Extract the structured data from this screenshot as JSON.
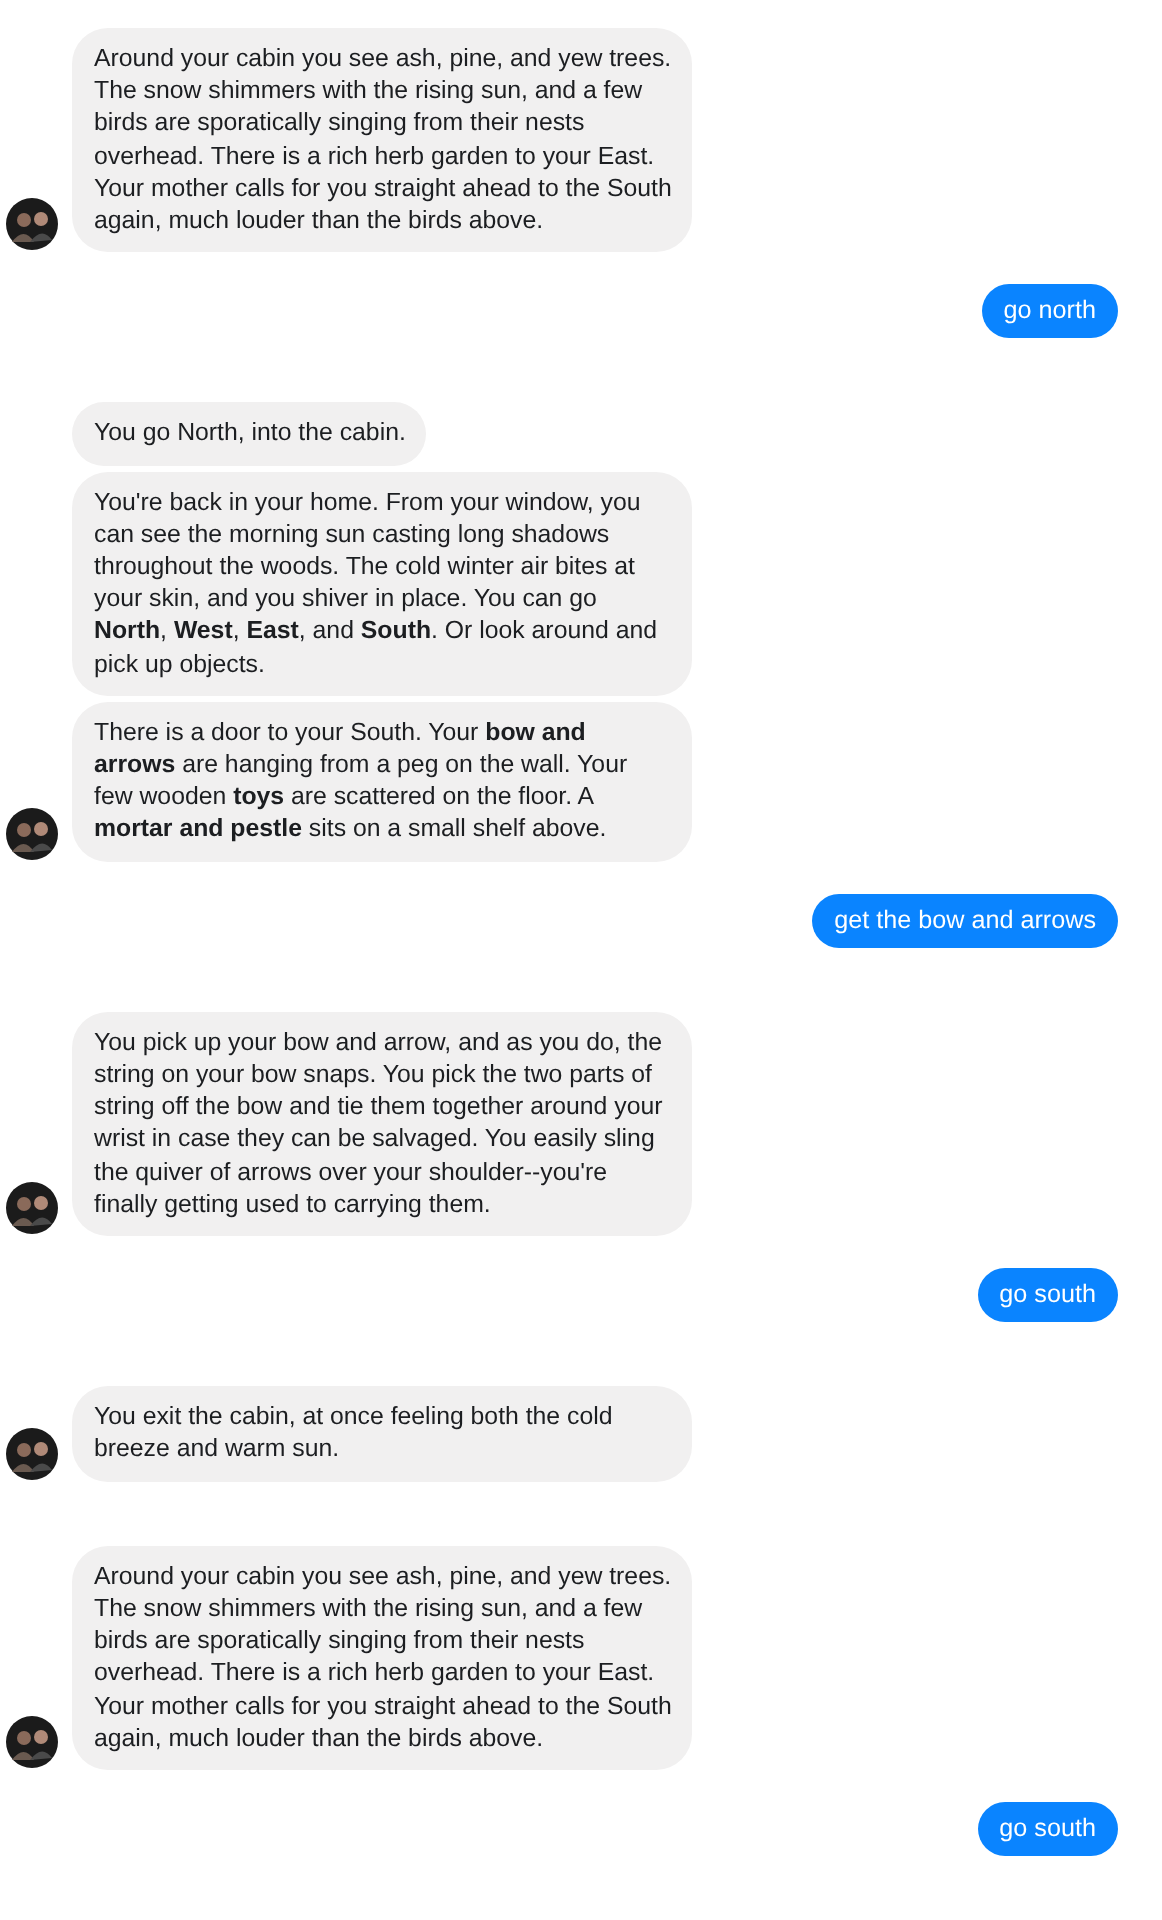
{
  "messages": [
    {
      "kind": "received",
      "bubbles": [
        "Around your cabin you see ash, pine, and yew trees. The snow shimmers with the rising sun, and a few birds are sporatically singing from their nests overhead. There is a rich herb garden to your East. Your mother calls for you straight ahead to the South again, much louder than the birds above."
      ]
    },
    {
      "kind": "sent",
      "bubbles": [
        "go north"
      ]
    },
    {
      "kind": "received",
      "bubbles": [
        "You go North, into the cabin.",
        "You're back in your home. From your window, you can see the morning sun casting long shadows throughout the woods. The cold winter air bites at your skin, and you shiver in place. You can go **North**, **West**, **East**, and **South**. Or look around and pick up objects.",
        "There is a door to your South.  Your **bow and arrows** are hanging from a peg on the wall. Your few wooden **toys** are scattered on the floor. A **mortar and pestle** sits on a small shelf above."
      ]
    },
    {
      "kind": "sent",
      "bubbles": [
        "get the bow and arrows"
      ]
    },
    {
      "kind": "received",
      "bubbles": [
        "You pick up your bow and arrow, and as you do, the string on your bow snaps. You pick the two parts of string off the bow and tie them together around your wrist in case they can be salvaged. You easily sling the quiver of arrows over your shoulder--you're finally getting used to carrying them."
      ]
    },
    {
      "kind": "sent",
      "bubbles": [
        "go south"
      ]
    },
    {
      "kind": "received",
      "bubbles": [
        "You exit the cabin, at once feeling both the cold breeze and warm sun."
      ]
    },
    {
      "kind": "received",
      "bubbles": [
        "Around your cabin you see ash, pine, and yew trees. The snow shimmers with the rising sun, and a few birds are sporatically singing from their nests overhead. There is a rich herb garden to your East. Your mother calls for you straight ahead to the South again, much louder than the birds above."
      ]
    },
    {
      "kind": "sent",
      "bubbles": [
        "go south"
      ]
    }
  ]
}
